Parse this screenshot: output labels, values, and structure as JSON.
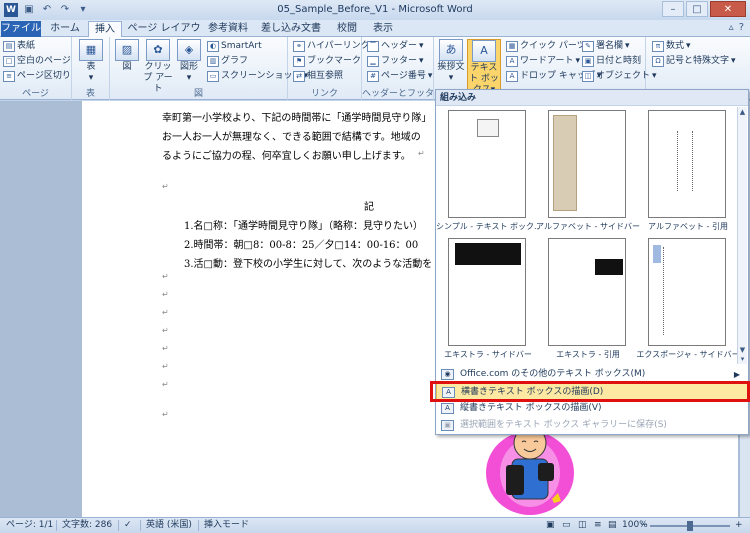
{
  "window": {
    "title": "05_Sample_Before_V1 - Microsoft Word",
    "app_icon": "W"
  },
  "tabs": [
    {
      "label": "ファイル"
    },
    {
      "label": "ホーム"
    },
    {
      "label": "挿入"
    },
    {
      "label": "ページ レイアウト"
    },
    {
      "label": "参考資料"
    },
    {
      "label": "差し込み文書"
    },
    {
      "label": "校閲"
    },
    {
      "label": "表示"
    }
  ],
  "ribbon": {
    "pages_group": {
      "label": "ページ",
      "cover": "表紙",
      "blank": "空白のページ",
      "break": "ページ区切り"
    },
    "table_group": {
      "label": "表",
      "table": "表"
    },
    "illustrations_group": {
      "label": "図",
      "picture": "図",
      "clipart": "クリップ アート",
      "shapes": "図形",
      "smartart": "SmartArt",
      "chart": "グラフ",
      "screenshot": "スクリーンショット"
    },
    "links_group": {
      "label": "リンク",
      "hyperlink": "ハイパーリンク",
      "bookmark": "ブックマーク",
      "crossref": "相互参照"
    },
    "header_footer_group": {
      "label": "ヘッダーとフッター",
      "header": "ヘッダー",
      "footer": "フッター",
      "page_number": "ページ番号"
    },
    "text_group": {
      "greeting": "挨拶文",
      "textbox": "テキスト ボックス",
      "quick_parts": "クイック パーツ",
      "wordart": "ワードアート",
      "dropcap": "ドロップ キャップ",
      "signature": "署名欄",
      "datetime": "日付と時刻",
      "object": "オブジェクト"
    },
    "symbols_group": {
      "equation": "数式",
      "symbol": "記号と特殊文字"
    }
  },
  "document": {
    "lines": [
      "幸町第一小学校より、下記の時間帯に「通学時間見守り隊」",
      "お一人お一人が無理なく、できる範囲で結構です。地域の",
      "るようにご協力の程、何卒宜しくお願い申し上げます。",
      "記",
      "1.名□称：「通学時間見守り隊」（略称：見守りたい）",
      "2.時間帯：朝□8：00-8：25／夕□14：00-16：00",
      "3.活□動：登下校の小学生に対して、次のような活動を"
    ],
    "para_mark": "↵"
  },
  "gallery": {
    "header": "組み込み",
    "thumbnails": [
      {
        "label": "シンプル - テキスト ボック..."
      },
      {
        "label": "アルファベット - サイドバー"
      },
      {
        "label": "アルファベット - 引用"
      },
      {
        "label": "エキストラ - サイドバー"
      },
      {
        "label": "エキストラ - 引用"
      },
      {
        "label": "エクスポージャ - サイドバー"
      }
    ],
    "menu": [
      {
        "label": "Office.com のその他のテキスト ボックス(M)",
        "icon": "office-icon",
        "enabled": true
      },
      {
        "label": "横書きテキスト ボックスの描画(D)",
        "icon": "textbox-draw-icon",
        "enabled": true
      },
      {
        "label": "縦書きテキスト ボックスの描画(V)",
        "icon": "vertical-textbox-icon",
        "enabled": true
      },
      {
        "label": "選択範囲をテキスト ボックス ギャラリーに保存(S)",
        "icon": "save-gallery-icon",
        "enabled": false
      }
    ]
  },
  "statusbar": {
    "page": "ページ: 1/1",
    "words": "文字数: 286",
    "language": "英語 (米国)",
    "mode": "挿入モード",
    "zoom": "100%"
  },
  "colors": {
    "accent": "#2a64b4",
    "highlight": "#fde9a2",
    "redbox": "#e01010"
  }
}
